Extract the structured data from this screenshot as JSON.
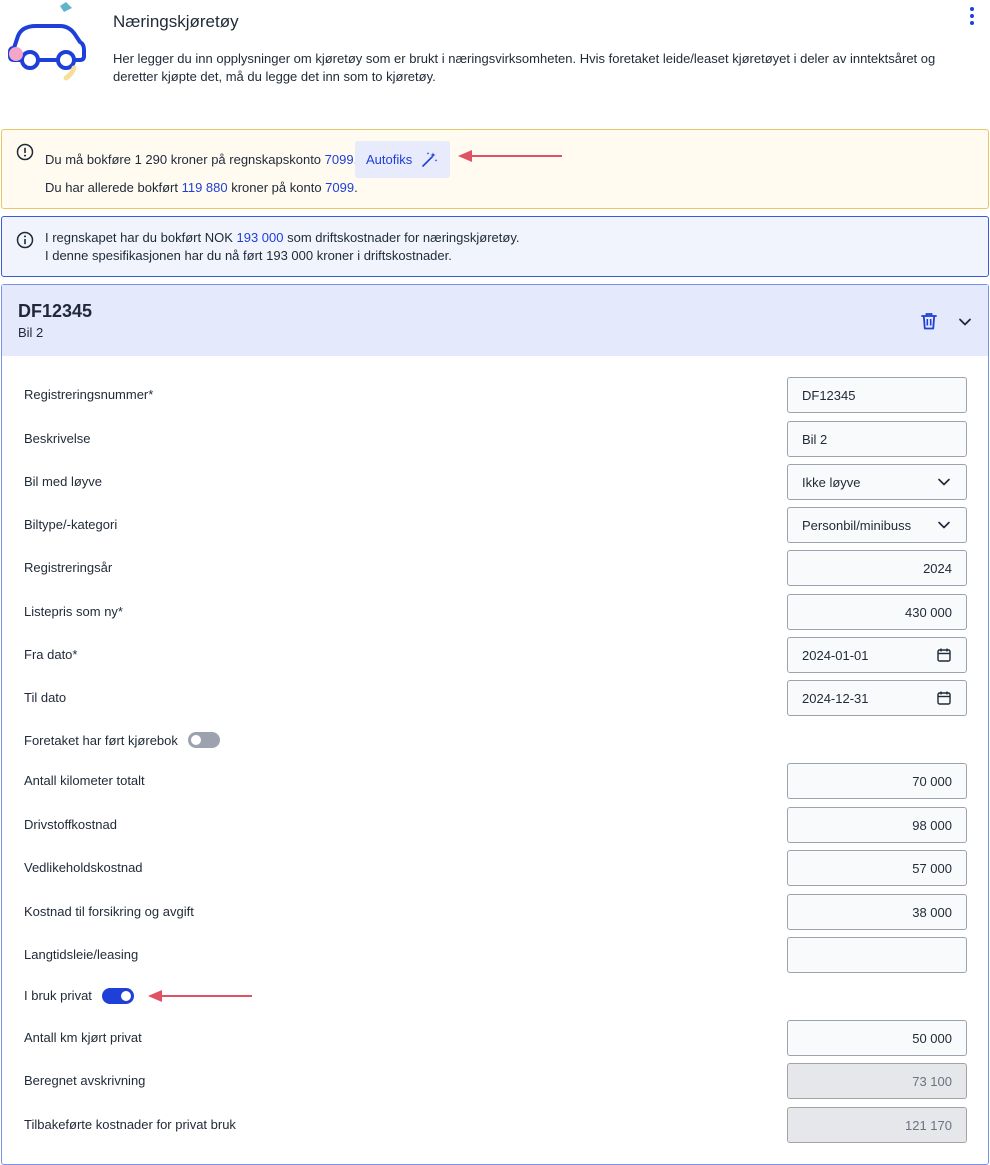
{
  "header": {
    "title": "Næringskjøretøy",
    "description": "Her legger du inn opplysninger om kjøretøy som er brukt i næringsvirksomheten. Hvis foretaket leide/leaset kjøretøyet i deler av inntektsåret og deretter kjøpte det, må du legge det inn som to kjøretøy.",
    "menu_icon": "kebab-menu-icon"
  },
  "warning": {
    "icon": "exclamation-circle-icon",
    "line1_pre": "Du må bokføre 1 290 kroner på regnskapskonto ",
    "line1_link": "7099",
    "line1_post": ".",
    "autofix_label": "Autofiks",
    "autofix_icon": "magic-wand-icon",
    "line2_pre": "Du har allerede bokført ",
    "line2_link1": "119 880",
    "line2_mid": " kroner på konto ",
    "line2_link2": "7099",
    "line2_post": "."
  },
  "info": {
    "icon": "info-circle-icon",
    "line1_pre": "I regnskapet har du bokført NOK ",
    "line1_link": "193 000",
    "line1_post": " som driftskostnader for næringskjøretøy.",
    "line2": "I denne spesifikasjonen har du nå ført 193 000 kroner i driftskostnader."
  },
  "vehicle": {
    "title": "DF12345",
    "subtitle": "Bil 2",
    "delete_icon": "trash-icon",
    "collapse_icon": "chevron-down-icon"
  },
  "form": {
    "reg_label": "Registreringsnummer*",
    "reg_value": "DF12345",
    "desc_label": "Beskrivelse",
    "desc_value": "Bil 2",
    "license_label": "Bil med løyve",
    "license_value": "Ikke løyve",
    "type_label": "Biltype/-kategori",
    "type_value": "Personbil/minibuss",
    "regyear_label": "Registreringsår",
    "regyear_value": "2024",
    "listprice_label": "Listepris som ny*",
    "listprice_value": "430 000",
    "from_label": "Fra dato*",
    "from_value": "2024-01-01",
    "to_label": "Til dato",
    "to_value": "2024-12-31",
    "logbook_label": "Foretaket har ført kjørebok",
    "logbook_on": false,
    "km_total_label": "Antall kilometer totalt",
    "km_total_value": "70 000",
    "fuel_label": "Drivstoffkostnad",
    "fuel_value": "98 000",
    "maint_label": "Vedlikeholdskostnad",
    "maint_value": "57 000",
    "insurance_label": "Kostnad til forsikring og avgift",
    "insurance_value": "38 000",
    "leasing_label": "Langtidsleie/leasing",
    "leasing_value": "",
    "private_label": "I bruk privat",
    "private_on": true,
    "km_private_label": "Antall km kjørt privat",
    "km_private_value": "50 000",
    "depreciation_label": "Beregnet avskrivning",
    "depreciation_value": "73 100",
    "reversed_label": "Tilbakeførte kostnader for privat bruk",
    "reversed_value": "121 170"
  },
  "colors": {
    "accent": "#1e40d8",
    "warning_border": "#e8c766",
    "warning_bg": "#fffbf0",
    "info_bg": "#f1f4fd",
    "arrow": "#e05263"
  }
}
